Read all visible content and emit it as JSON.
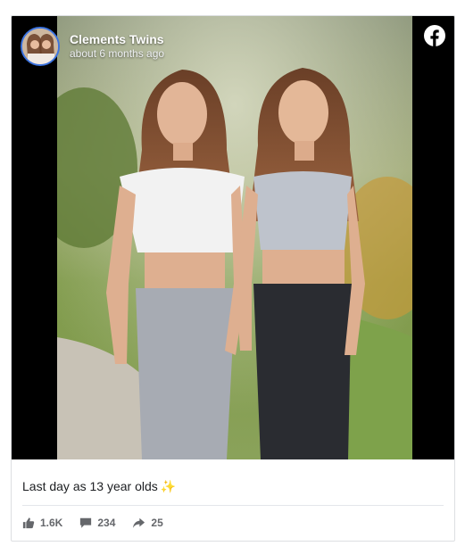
{
  "post": {
    "page_name": "Clements Twins",
    "time": "about 6 months ago",
    "caption": "Last day as 13 year olds",
    "caption_emoji": "✨"
  },
  "stats": {
    "likes": "1.6K",
    "comments": "234",
    "shares": "25"
  },
  "colors": {
    "brand": "#1877f2",
    "avatar_ring": "#3b73e0",
    "meta_text": "#65676b"
  },
  "icons": {
    "logo": "facebook-logo-icon",
    "like": "thumbs-up-icon",
    "comment": "comment-bubble-icon",
    "share": "share-arrow-icon"
  }
}
